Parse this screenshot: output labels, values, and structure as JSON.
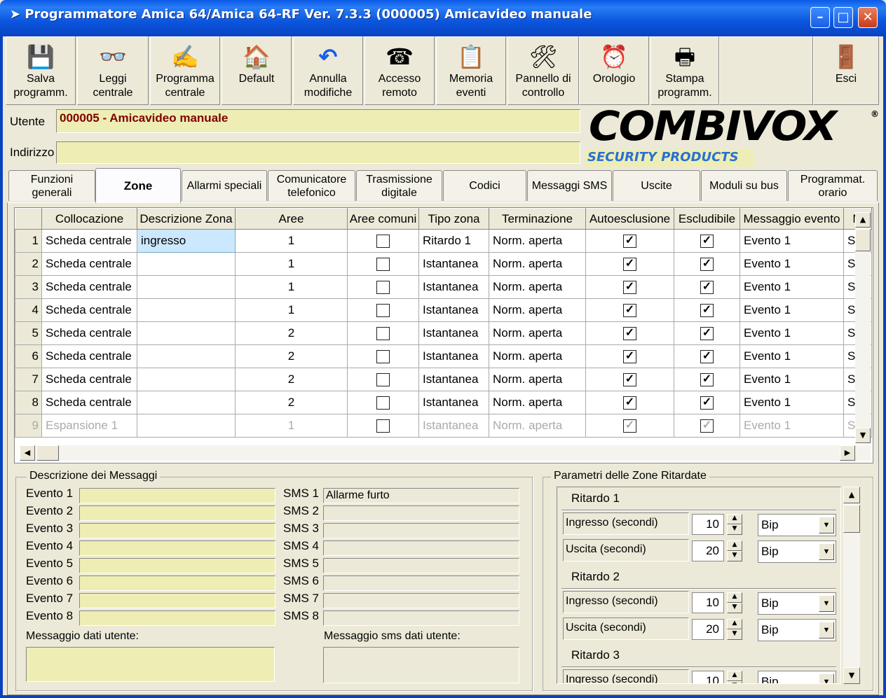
{
  "window": {
    "title": "Programmatore Amica 64/Amica 64-RF Ver. 7.3.3  (000005) Amicavideo manuale"
  },
  "toolbar": [
    {
      "label1": "Salva",
      "label2": "programm.",
      "icon": "floppy-icon"
    },
    {
      "label1": "Leggi",
      "label2": "centrale",
      "icon": "glasses-icon"
    },
    {
      "label1": "Programma",
      "label2": "centrale",
      "icon": "pen-icon"
    },
    {
      "label1": "Default",
      "label2": "",
      "icon": "home-icon"
    },
    {
      "label1": "Annulla",
      "label2": "modifiche",
      "icon": "undo-icon"
    },
    {
      "label1": "Accesso",
      "label2": "remoto",
      "icon": "phone-globe-icon"
    },
    {
      "label1": "Memoria",
      "label2": "eventi",
      "icon": "memo-icon"
    },
    {
      "label1": "Pannello di",
      "label2": "controllo",
      "icon": "control-panel-icon"
    },
    {
      "label1": "Orologio",
      "label2": "",
      "icon": "clock-icon"
    },
    {
      "label1": "Stampa",
      "label2": "programm.",
      "icon": "printer-icon"
    },
    {
      "label1": "",
      "label2": "Esci",
      "icon": "exit-icon"
    }
  ],
  "user": {
    "label": "Utente",
    "value": "000005 - Amicavideo manuale"
  },
  "address": {
    "label": "Indirizzo",
    "value": ""
  },
  "logo": {
    "brand": "COMBIVOX",
    "sub": "SECURITY PRODUCTS"
  },
  "tabs": [
    {
      "label1": "Funzioni",
      "label2": "generali"
    },
    {
      "label1": "Zone",
      "label2": ""
    },
    {
      "label1": "Allarmi speciali",
      "label2": ""
    },
    {
      "label1": "Comunicatore",
      "label2": "telefonico"
    },
    {
      "label1": "Trasmissione",
      "label2": "digitale"
    },
    {
      "label1": "Codici",
      "label2": ""
    },
    {
      "label1": "Messaggi  SMS",
      "label2": ""
    },
    {
      "label1": "Uscite",
      "label2": ""
    },
    {
      "label1": "Moduli su bus",
      "label2": ""
    },
    {
      "label1": "Programmat.",
      "label2": "orario"
    }
  ],
  "grid": {
    "columns": [
      "Collocazione",
      "Descrizione Zona",
      "Aree",
      "Aree comuni",
      "Tipo zona",
      "Terminazione",
      "Autoesclusione",
      "Escludibile",
      "Messaggio evento",
      "M"
    ],
    "rows": [
      {
        "n": "1",
        "loc": "Scheda centrale",
        "desc": "ingresso",
        "aree": "1",
        "comuni": false,
        "tipo": "Ritardo 1",
        "term": "Norm. aperta",
        "auto": true,
        "escl": true,
        "msg": "Evento 1",
        "m": "S"
      },
      {
        "n": "2",
        "loc": "Scheda centrale",
        "desc": "",
        "aree": "1",
        "comuni": false,
        "tipo": "Istantanea",
        "term": "Norm. aperta",
        "auto": true,
        "escl": true,
        "msg": "Evento 1",
        "m": "S"
      },
      {
        "n": "3",
        "loc": "Scheda centrale",
        "desc": "",
        "aree": "1",
        "comuni": false,
        "tipo": "Istantanea",
        "term": "Norm. aperta",
        "auto": true,
        "escl": true,
        "msg": "Evento 1",
        "m": "S"
      },
      {
        "n": "4",
        "loc": "Scheda centrale",
        "desc": "",
        "aree": "1",
        "comuni": false,
        "tipo": "Istantanea",
        "term": "Norm. aperta",
        "auto": true,
        "escl": true,
        "msg": "Evento 1",
        "m": "S"
      },
      {
        "n": "5",
        "loc": "Scheda centrale",
        "desc": "",
        "aree": "2",
        "comuni": false,
        "tipo": "Istantanea",
        "term": "Norm. aperta",
        "auto": true,
        "escl": true,
        "msg": "Evento 1",
        "m": "S"
      },
      {
        "n": "6",
        "loc": "Scheda centrale",
        "desc": "",
        "aree": "2",
        "comuni": false,
        "tipo": "Istantanea",
        "term": "Norm. aperta",
        "auto": true,
        "escl": true,
        "msg": "Evento 1",
        "m": "S"
      },
      {
        "n": "7",
        "loc": "Scheda centrale",
        "desc": "",
        "aree": "2",
        "comuni": false,
        "tipo": "Istantanea",
        "term": "Norm. aperta",
        "auto": true,
        "escl": true,
        "msg": "Evento 1",
        "m": "S"
      },
      {
        "n": "8",
        "loc": "Scheda centrale",
        "desc": "",
        "aree": "2",
        "comuni": false,
        "tipo": "Istantanea",
        "term": "Norm. aperta",
        "auto": true,
        "escl": true,
        "msg": "Evento 1",
        "m": "S"
      },
      {
        "n": "9",
        "loc": "Espansione 1",
        "desc": "",
        "aree": "1",
        "comuni": false,
        "tipo": "Istantanea",
        "term": "Norm. aperta",
        "auto": true,
        "escl": true,
        "msg": "Evento 1",
        "m": "S",
        "dim": true
      }
    ]
  },
  "messages": {
    "group_title": "Descrizione dei Messaggi",
    "events": [
      "Evento 1",
      "Evento 2",
      "Evento 3",
      "Evento 4",
      "Evento 5",
      "Evento 6",
      "Evento 7",
      "Evento 8"
    ],
    "sms_labels": [
      "SMS 1",
      "SMS 2",
      "SMS 3",
      "SMS 4",
      "SMS 5",
      "SMS 6",
      "SMS 7",
      "SMS 8"
    ],
    "sms_values": [
      "Allarme furto",
      "",
      "",
      "",
      "",
      "",
      "",
      ""
    ],
    "user_msg_label": "Messaggio dati utente:",
    "user_sms_label": "Messaggio sms dati utente:"
  },
  "delays": {
    "group_title": "Parametri delle Zone Ritardate",
    "sections": [
      {
        "title": "Ritardo 1",
        "rows": [
          {
            "label": "Ingresso (secondi)",
            "value": "10",
            "mode": "Bip"
          },
          {
            "label": "Uscita (secondi)",
            "value": "20",
            "mode": "Bip"
          }
        ]
      },
      {
        "title": "Ritardo 2",
        "rows": [
          {
            "label": "Ingresso (secondi)",
            "value": "10",
            "mode": "Bip"
          },
          {
            "label": "Uscita (secondi)",
            "value": "20",
            "mode": "Bip"
          }
        ]
      },
      {
        "title": "Ritardo 3",
        "rows": [
          {
            "label": "Ingresso (secondi)",
            "value": "10",
            "mode": "Bip"
          }
        ]
      }
    ]
  }
}
